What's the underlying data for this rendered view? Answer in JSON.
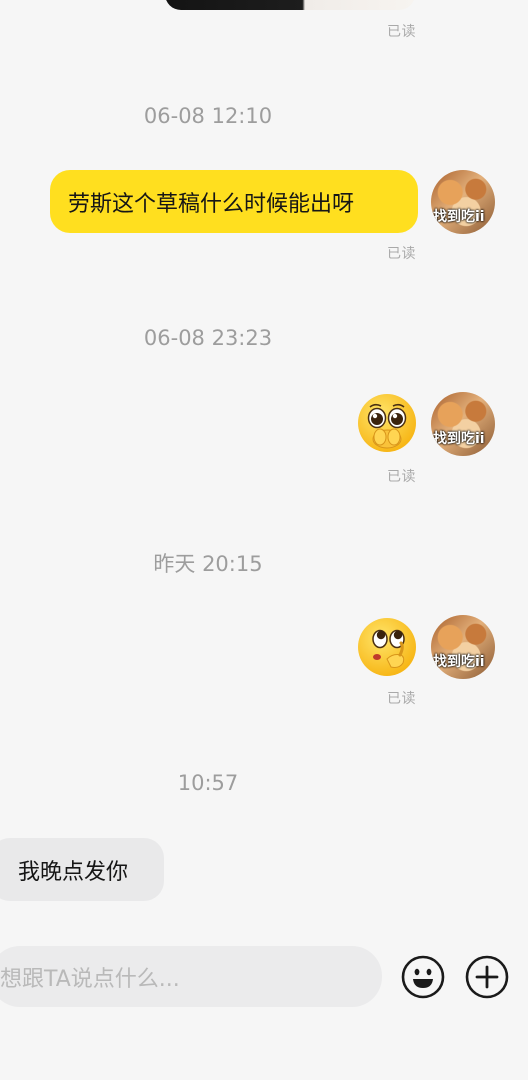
{
  "conversation": {
    "top_read_status": "已读",
    "messages": [
      {
        "timestamp": "06-08 12:10",
        "text": "劳斯这个草稿什么时候能出呀",
        "read_status": "已读"
      },
      {
        "timestamp": "06-08 23:23",
        "emoji": "pleading-face-emoji",
        "read_status": "已读"
      },
      {
        "timestamp": "昨天 20:15",
        "emoji": "thinking-face-emoji",
        "read_status": "已读"
      },
      {
        "timestamp": "10:57",
        "text": "我晚点发你"
      }
    ],
    "avatar_caption": "找到吃ii"
  },
  "composer": {
    "placeholder": "想跟TA说点什么...",
    "emoji_button": "smile-icon",
    "plus_button": "plus-icon"
  },
  "colors": {
    "background": "#f6f6f6",
    "my_bubble": "#ffdf1f",
    "their_bubble": "#e9e9ea",
    "meta_text": "#a9a9a9"
  }
}
